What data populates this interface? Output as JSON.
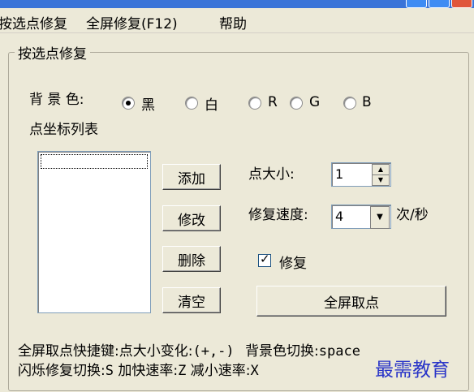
{
  "menu": {
    "items": [
      "按选点修复",
      "全屏修复(F12)",
      "帮助"
    ]
  },
  "group": {
    "title": "按选点修复"
  },
  "background": {
    "label": "背 景 色:",
    "options": [
      "黑",
      "白",
      "R",
      "G",
      "B"
    ],
    "selected": "黑"
  },
  "point_list": {
    "label": "点坐标列表"
  },
  "buttons": {
    "add": "添加",
    "modify": "修改",
    "delete": "删除",
    "clear": "清空",
    "fullscreen_pick": "全屏取点"
  },
  "point_size": {
    "label": "点大小:",
    "value": "1"
  },
  "repair_speed": {
    "label": "修复速度:",
    "value": "4",
    "unit": "次/秒"
  },
  "repair_check": {
    "label": "修复",
    "checked": true
  },
  "hints": {
    "line1_a": "全屏取点快捷键:点大小变化:",
    "line1_b": "(+,-)",
    "line1_c": "背景色切换:",
    "line1_d": "space",
    "line2_a": "闪烁修复切换:",
    "line2_b": "S",
    "line2_c": "加快速率:",
    "line2_d": "Z",
    "line2_e": "减小速率:",
    "line2_f": "X"
  },
  "watermark": "最需教育"
}
